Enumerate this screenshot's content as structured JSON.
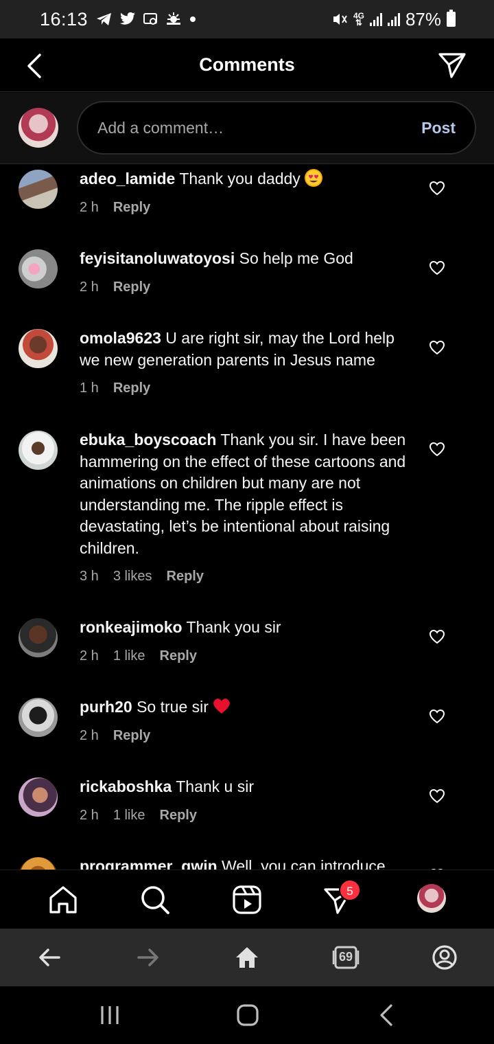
{
  "status_bar": {
    "time": "16:13",
    "battery": "87%",
    "network": "4G",
    "left_icons": [
      "telegram-icon",
      "twitter-icon",
      "cast-icon",
      "weather-icon",
      "dot-icon"
    ],
    "right_icons": [
      "mute-icon",
      "network-4g-icon",
      "signal-icon",
      "signal-icon",
      "battery-icon"
    ]
  },
  "header": {
    "title": "Comments"
  },
  "composer": {
    "placeholder": "Add a comment…",
    "post_label": "Post"
  },
  "comments": [
    {
      "username": "adeo_lamide",
      "text": "Thank you daddy",
      "emoji": "heart-eyes-emoji",
      "time": "2 h",
      "likes": "",
      "reply": "Reply"
    },
    {
      "username": "feyisitanoluwatoyosi",
      "text": "So help me God",
      "time": "2 h",
      "likes": "",
      "reply": "Reply"
    },
    {
      "username": "omola9623",
      "text": "U are right sir, may the Lord help we new generation parents in Jesus name",
      "time": "1 h",
      "likes": "",
      "reply": "Reply"
    },
    {
      "username": "ebuka_boyscoach",
      "text": "Thank you sir. I have been hammering on the effect of these cartoons and animations on children but many are not understanding me. The ripple effect is devastating, let’s be intentional about raising children.",
      "time": "3 h",
      "likes": "3 likes",
      "reply": "Reply"
    },
    {
      "username": "ronkeajimoko",
      "text": "Thank you sir",
      "time": "2 h",
      "likes": "1 like",
      "reply": "Reply"
    },
    {
      "username": "purh20",
      "text": "So true sir",
      "emoji": "red-heart-emoji",
      "time": "2 h",
      "likes": "",
      "reply": "Reply"
    },
    {
      "username": "rickaboshka",
      "text": "Thank u sir",
      "time": "2 h",
      "likes": "1 like",
      "reply": "Reply"
    },
    {
      "username": "programmer_gwin",
      "text": "Well, you can introduce",
      "time": "",
      "likes": "",
      "reply": ""
    }
  ],
  "ig_nav": {
    "items": [
      "home-icon",
      "search-icon",
      "reels-icon",
      "direct-messages-icon",
      "profile-avatar"
    ],
    "messages_badge": "5"
  },
  "browser_bar": {
    "items": [
      "back-arrow-icon",
      "forward-arrow-icon",
      "home-icon",
      "tabs-icon",
      "account-icon"
    ],
    "tab_count": "69"
  },
  "system_nav": {
    "items": [
      "recents-icon",
      "home-icon",
      "back-icon"
    ]
  },
  "colors": {
    "background": "#000000",
    "status_bar": "#222222",
    "composer_bg": "#111111",
    "post_button": "#b6c7ea",
    "meta_text": "#a8a8a8",
    "badge": "#ff3040",
    "browser_bar": "#2b2b2b"
  }
}
